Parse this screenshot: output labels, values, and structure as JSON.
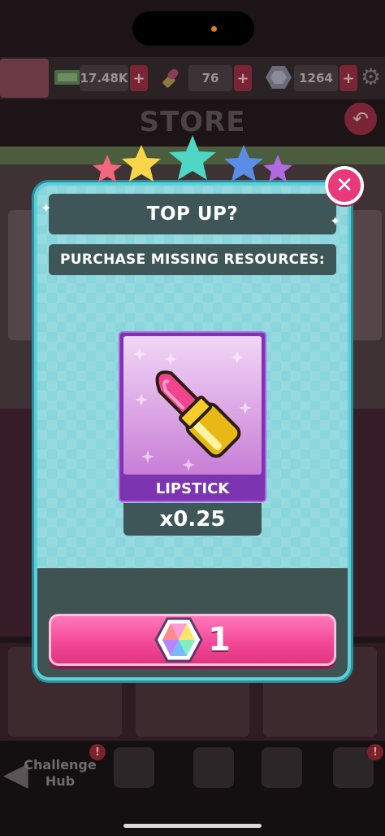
{
  "resources": {
    "cash": {
      "icon": "cash-icon",
      "value": "17.48K"
    },
    "lipstick": {
      "icon": "lipstick-icon",
      "value": "76"
    },
    "gems": {
      "icon": "gem-icon",
      "value": "1264"
    }
  },
  "store": {
    "title": "STORE"
  },
  "modal": {
    "title": "TOP UP?",
    "subtitle": "PURCHASE MISSING RESOURCES:",
    "item": {
      "name": "LIPSTICK",
      "icon": "lipstick-icon",
      "quantity": "x0.25"
    },
    "buy_button": {
      "icon": "gem-icon",
      "cost": "1"
    }
  },
  "bottom_nav": {
    "challenge_hub": "Challenge Hub",
    "badge": "!"
  },
  "colors": {
    "modal_bg": "#8ad6dd",
    "panel_dark": "#3e5657",
    "buy_pink": "#f24696",
    "item_purple": "#7c34b0",
    "close_pink": "#e8397a"
  }
}
